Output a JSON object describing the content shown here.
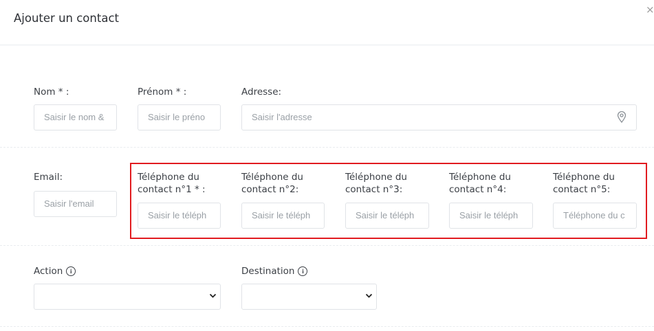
{
  "modal": {
    "title": "Ajouter un contact",
    "close_glyph": "×"
  },
  "fields": {
    "nom": {
      "label": "Nom * :",
      "placeholder": "Saisir le nom &"
    },
    "prenom": {
      "label": "Prénom * :",
      "placeholder": "Saisir le préno"
    },
    "adresse": {
      "label": "Adresse:",
      "placeholder": "Saisir l'adresse",
      "icon": "map-pin-icon"
    },
    "email": {
      "label": "Email:",
      "placeholder": "Saisir l'email"
    },
    "phones": [
      {
        "label_line1": "Téléphone du",
        "label_line2": "contact n°1 * :",
        "placeholder": "Saisir le téléph"
      },
      {
        "label_line1": "Téléphone du",
        "label_line2": "contact n°2:",
        "placeholder": "Saisir le téléph"
      },
      {
        "label_line1": "Téléphone du",
        "label_line2": "contact n°3:",
        "placeholder": "Saisir le téléph"
      },
      {
        "label_line1": "Téléphone du",
        "label_line2": "contact n°4:",
        "placeholder": "Saisir le téléph"
      },
      {
        "label_line1": "Téléphone du",
        "label_line2": "contact n°5:",
        "placeholder": "Téléphone du c"
      }
    ],
    "action": {
      "label": "Action",
      "value": "",
      "icon": "info-icon"
    },
    "destination": {
      "label": "Destination",
      "value": "",
      "icon": "info-icon"
    }
  },
  "colors": {
    "highlight": "#e11b1f",
    "border": "#e0e3e7",
    "placeholder": "#9aa0a6"
  }
}
